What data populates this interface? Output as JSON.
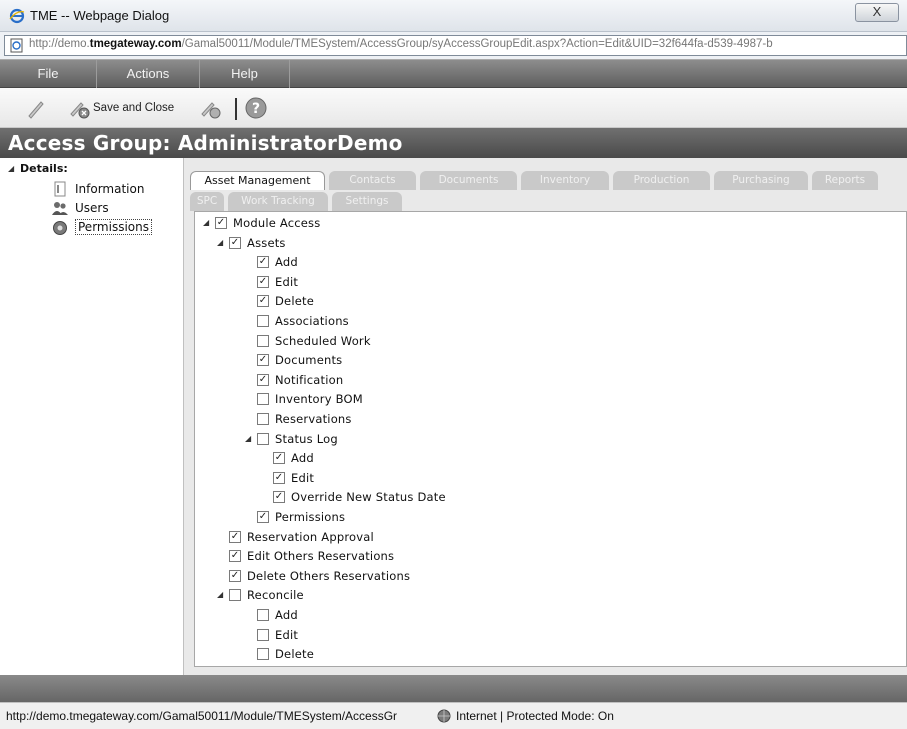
{
  "window": {
    "title": "TME -- Webpage Dialog",
    "close_glyph": "X",
    "url_prefix": "http://demo.",
    "url_domain": "tmegateway.com",
    "url_rest": "/Gamal50011/Module/TMESystem/AccessGroup/syAccessGroupEdit.aspx?Action=Edit&UID=32f644fa-d539-4987-b"
  },
  "menu": [
    "File",
    "Actions",
    "Help"
  ],
  "toolbar": {
    "save_label": "Save and Close"
  },
  "header": {
    "title": "Access Group: AdministratorDemo"
  },
  "sidebar": {
    "section": "Details:",
    "items": [
      {
        "label": "Information",
        "icon": "info-icon"
      },
      {
        "label": "Users",
        "icon": "users-icon"
      },
      {
        "label": "Permissions",
        "icon": "permissions-icon",
        "selected": true
      }
    ]
  },
  "tabs": {
    "row1": [
      "Asset Management",
      "Contacts",
      "Documents",
      "Inventory",
      "Production",
      "Purchasing",
      "Reports"
    ],
    "row2": [
      "SPC",
      "Work Tracking",
      "Settings"
    ],
    "active": "Asset Management"
  },
  "tree": [
    {
      "label": "Module Access",
      "checked": true,
      "level": 0,
      "expander": true
    },
    {
      "label": "Assets",
      "checked": true,
      "level": 1,
      "expander": true
    },
    {
      "label": "Add",
      "checked": true,
      "level": 2
    },
    {
      "label": "Edit",
      "checked": true,
      "level": 2
    },
    {
      "label": "Delete",
      "checked": true,
      "level": 2
    },
    {
      "label": "Associations",
      "checked": false,
      "level": 2
    },
    {
      "label": "Scheduled Work",
      "checked": false,
      "level": 2
    },
    {
      "label": "Documents",
      "checked": true,
      "level": 2
    },
    {
      "label": "Notification",
      "checked": true,
      "level": 2
    },
    {
      "label": "Inventory BOM",
      "checked": false,
      "level": 2
    },
    {
      "label": "Reservations",
      "checked": false,
      "level": 2
    },
    {
      "label": "Status Log",
      "checked": false,
      "level": 2,
      "expander": true
    },
    {
      "label": "Add",
      "checked": true,
      "level": 3
    },
    {
      "label": "Edit",
      "checked": true,
      "level": 3
    },
    {
      "label": "Override New Status Date",
      "checked": true,
      "level": 3
    },
    {
      "label": "Permissions",
      "checked": true,
      "level": 2
    },
    {
      "label": "Reservation Approval",
      "checked": true,
      "level": 1
    },
    {
      "label": "Edit Others Reservations",
      "checked": true,
      "level": 1
    },
    {
      "label": "Delete Others Reservations",
      "checked": true,
      "level": 1
    },
    {
      "label": "Reconcile",
      "checked": false,
      "level": 1,
      "expander": true
    },
    {
      "label": "Add",
      "checked": false,
      "level": 2
    },
    {
      "label": "Edit",
      "checked": false,
      "level": 2
    },
    {
      "label": "Delete",
      "checked": false,
      "level": 2
    }
  ],
  "statusbar": {
    "url": "http://demo.tmegateway.com/Gamal50011/Module/TMESystem/AccessGr",
    "zone": "Internet | Protected Mode: On"
  },
  "colors": {
    "header_bg": "#5a5a5a",
    "menubar_bg": "#777777",
    "tab_inactive": "#c9c9c9",
    "panel_bg": "#e9e9e9"
  }
}
